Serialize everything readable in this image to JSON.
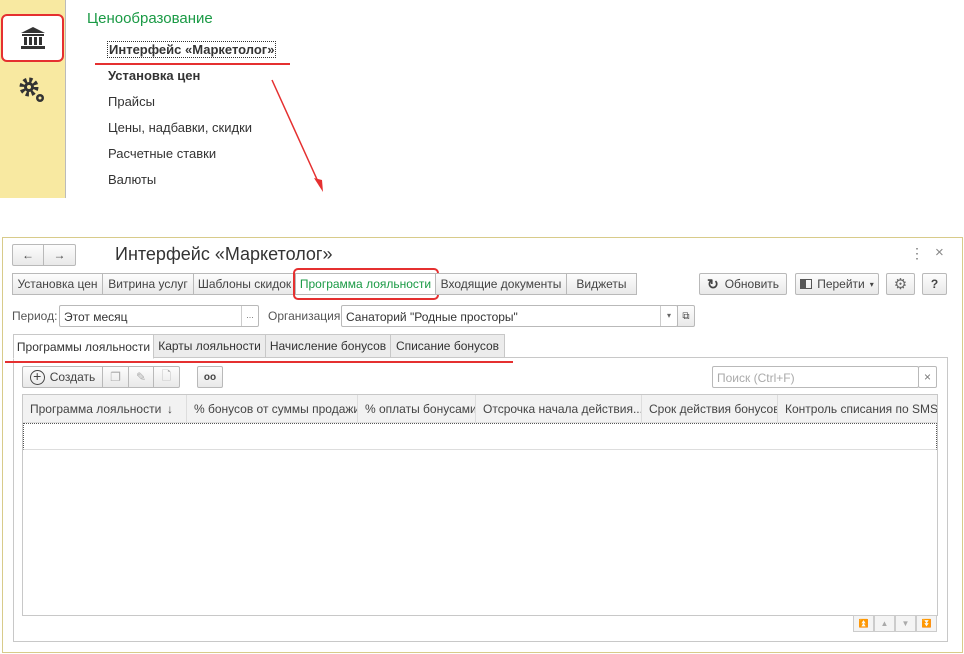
{
  "sidebar": {
    "sections": [
      {
        "icon": "bank-icon",
        "selected": true
      },
      {
        "icon": "gears-icon",
        "selected": false
      }
    ]
  },
  "menu": {
    "title": "Ценообразование",
    "items": [
      "Интерфейс «Маркетолог»",
      "Установка цен",
      "Прайсы",
      "Цены, надбавки, скидки",
      "Расчетные ставки",
      "Валюты"
    ]
  },
  "window": {
    "title": "Интерфейс «Маркетолог»",
    "nav": {
      "back": "←",
      "forward": "→"
    },
    "more": "⋮",
    "close": "×",
    "commands": [
      "Установка цен",
      "Витрина услуг",
      "Шаблоны скидок",
      "Программа лояльности",
      "Входящие документы",
      "Виджеты"
    ],
    "refresh": "Обновить",
    "goto": "Перейти",
    "help": "?",
    "period_label": "Период:",
    "period_value": "Этот месяц",
    "ellipsis": "...",
    "org_label": "Организация:",
    "org_value": "Санаторий \"Родные просторы\"",
    "tabs": [
      "Программы лояльности",
      "Карты лояльности",
      "Начисление бонусов",
      "Списание бонусов"
    ],
    "create": "Создать",
    "search_placeholder": "Поиск (Ctrl+F)",
    "search_clear": "×",
    "columns": [
      "Программа лояльности",
      "% бонусов от суммы продажи",
      "% оплаты бонусами",
      "Отсрочка начала действия...",
      "Срок действия бонусов",
      "Контроль списания по SMS"
    ],
    "sort_indicator": "↓"
  },
  "colors": {
    "accent_green": "#1a9a45",
    "annotation_red": "#e53030",
    "sidebar_bg": "#f8e9a1"
  }
}
